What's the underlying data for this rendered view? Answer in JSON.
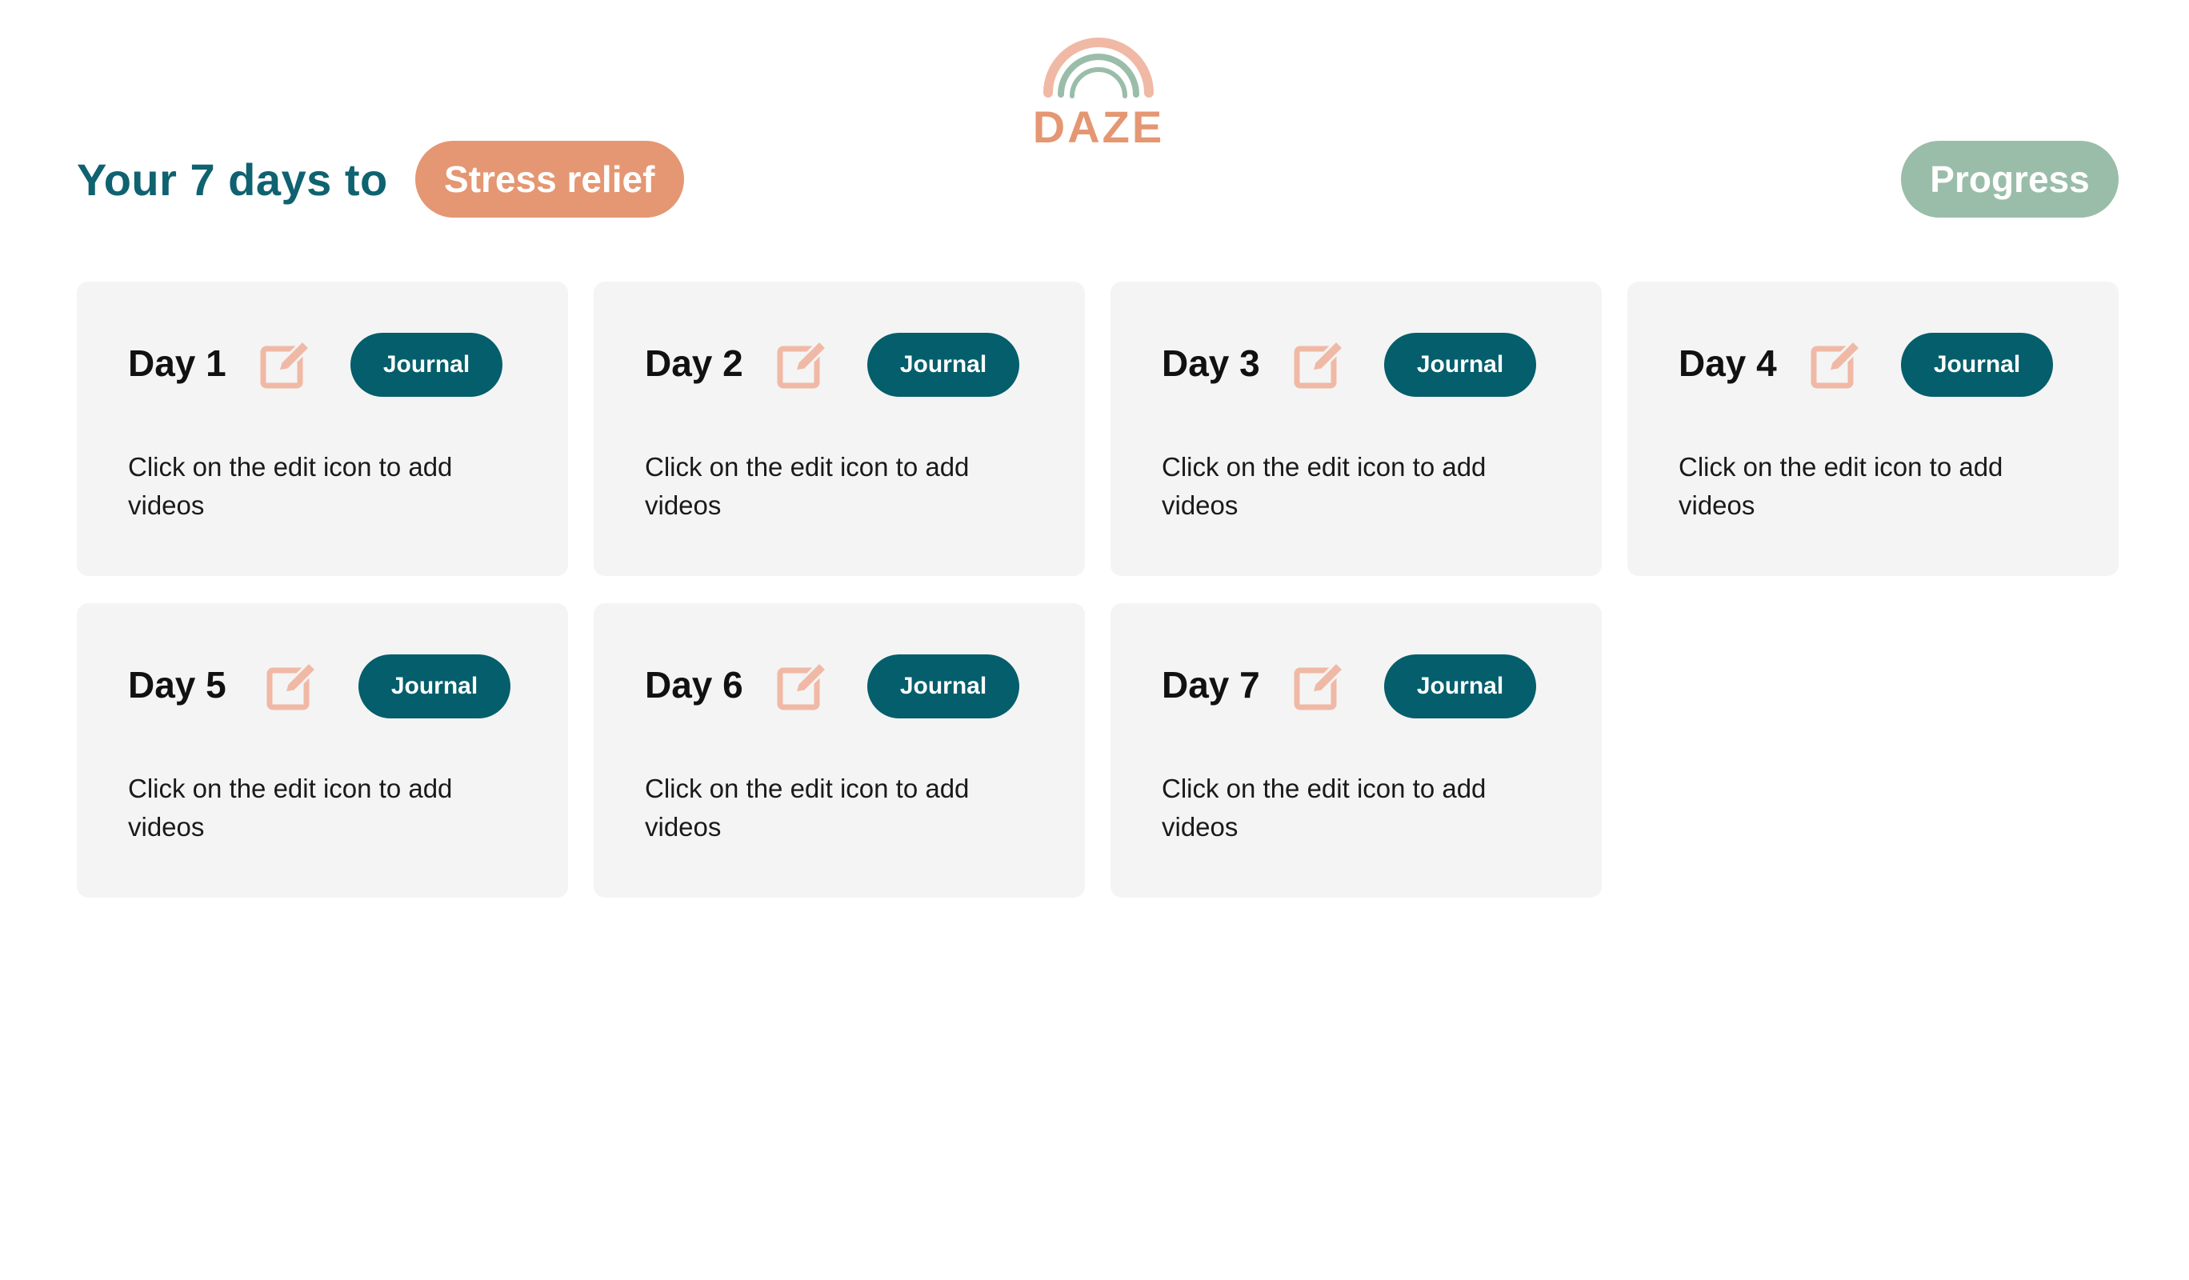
{
  "logo": {
    "text": "DAZE",
    "icon": "rainbow-logo-icon"
  },
  "header": {
    "headline": "Your 7 days to",
    "goal_label": "Stress relief",
    "progress_label": "Progress"
  },
  "colors": {
    "headline": "#0f6270",
    "goal_pill": "#e49772",
    "progress_button": "#9abda9",
    "journal_button": "#045e6b",
    "edit_icon": "#f0b9a5",
    "card_background": "#f4f4f4"
  },
  "days": [
    {
      "title": "Day 1",
      "journal_label": "Journal",
      "description": "Click on the edit icon to add videos",
      "icon": "edit-icon"
    },
    {
      "title": "Day 2",
      "journal_label": "Journal",
      "description": "Click on the edit icon to add videos",
      "icon": "edit-icon"
    },
    {
      "title": "Day 3",
      "journal_label": "Journal",
      "description": "Click on the edit icon to add videos",
      "icon": "edit-icon"
    },
    {
      "title": "Day 4",
      "journal_label": "Journal",
      "description": "Click on the edit icon to add videos",
      "icon": "edit-icon"
    },
    {
      "title": "Day 5",
      "journal_label": "Journal",
      "description": "Click on the edit icon to add videos",
      "icon": "edit-icon"
    },
    {
      "title": "Day 6",
      "journal_label": "Journal",
      "description": "Click on the edit icon to add videos",
      "icon": "edit-icon"
    },
    {
      "title": "Day 7",
      "journal_label": "Journal",
      "description": "Click on the edit icon to add videos",
      "icon": "edit-icon"
    }
  ]
}
